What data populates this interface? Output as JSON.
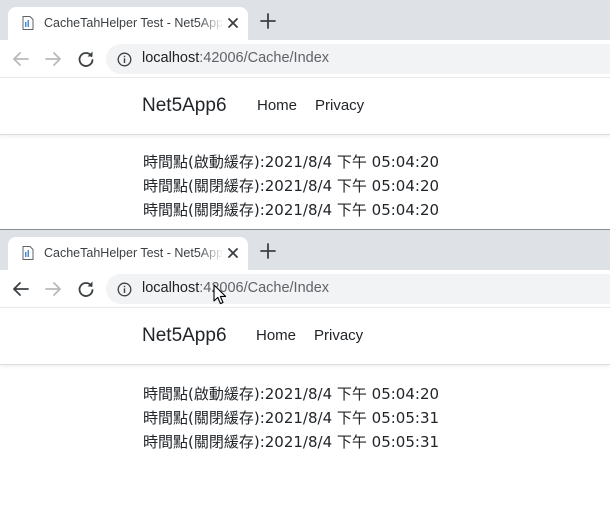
{
  "browser": {
    "tab_title": "CacheTahHelper Test - Net5App6",
    "url_host": "localhost",
    "url_rest": ":42006/Cache/Index"
  },
  "site": {
    "brand": "Net5App6",
    "nav": [
      "Home",
      "Privacy"
    ]
  },
  "screenshots": [
    {
      "lines": [
        "時間點(啟動緩存):2021/8/4 下午 05:04:20",
        "時間點(關閉緩存):2021/8/4 下午 05:04:20",
        "時間點(關閉緩存):2021/8/4 下午 05:04:20"
      ]
    },
    {
      "lines": [
        "時間點(啟動緩存):2021/8/4 下午 05:04:20",
        "時間點(關閉緩存):2021/8/4 下午 05:05:31",
        "時間點(關閉緩存):2021/8/4 下午 05:05:31"
      ]
    }
  ],
  "colors": {
    "tabstrip": "#dee1e6",
    "omnibox": "#f1f3f4",
    "text": "#212529",
    "url_dim": "#5f6368"
  },
  "icons": [
    "page-favicon-icon",
    "close-icon",
    "plus-icon",
    "back-arrow-icon",
    "forward-arrow-icon",
    "reload-icon",
    "info-icon",
    "mouse-cursor-icon"
  ]
}
